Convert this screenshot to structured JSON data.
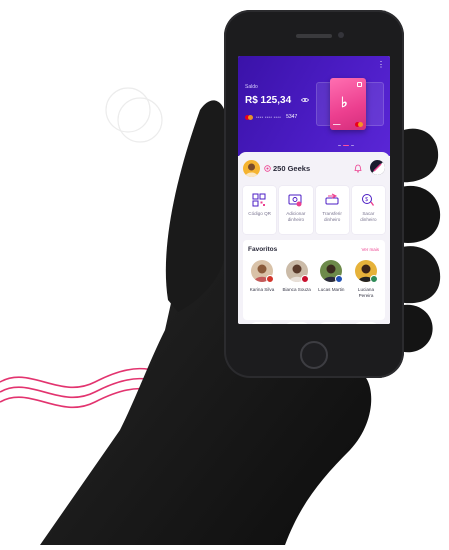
{
  "header": {
    "saldo_label": "Saldo",
    "balance": "R$ 125,34",
    "card_masked": "**** **** ****",
    "card_last": "5347",
    "menu_icon": "more-vertical-icon"
  },
  "geeks": {
    "amount": "250 Geeks"
  },
  "actions": [
    {
      "label": "Código QR",
      "icon": "qr-code-icon"
    },
    {
      "label": "Adicionar dinheiro",
      "icon": "add-money-icon"
    },
    {
      "label": "Transferir dinheiro",
      "icon": "transfer-icon"
    },
    {
      "label": "Sacar dinheiro",
      "icon": "withdraw-icon"
    }
  ],
  "favorites": {
    "title": "Favoritos",
    "see_more": "Ver mais",
    "people": [
      {
        "name": "Karina Silva"
      },
      {
        "name": "Bianca Souza"
      },
      {
        "name": "Lucas Martin"
      },
      {
        "name": "Luciana Pereira"
      }
    ]
  },
  "colors": {
    "primary_purple": "#4b1cc4",
    "accent_pink": "#ec3f8f",
    "background": "#f4f2f8"
  }
}
